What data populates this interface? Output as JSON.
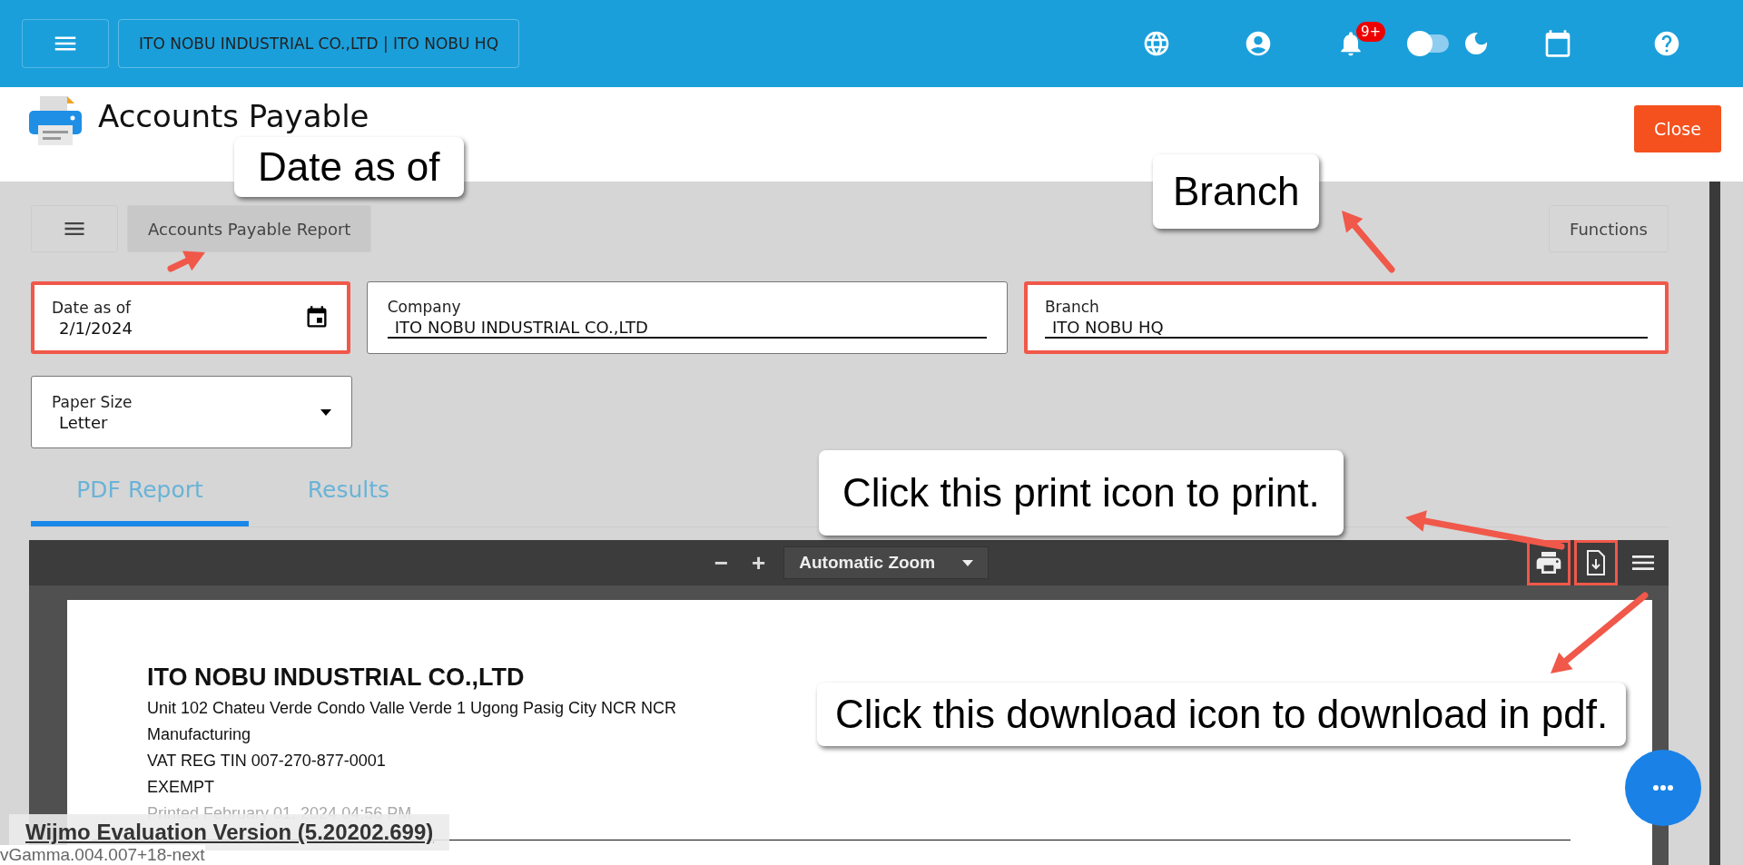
{
  "top_bar": {
    "company_branch": "ITO NOBU INDUSTRIAL CO.,LTD | ITO NOBU HQ",
    "notification_badge": "9+",
    "dark_mode": false
  },
  "header": {
    "title": "Accounts Payable",
    "close_button": "Close"
  },
  "toolbar": {
    "report_tab": "Accounts Payable Report",
    "functions_button": "Functions"
  },
  "fields": [
    {
      "kind": "date",
      "label": "Date as of",
      "value": "2/1/2024",
      "highlighted": true
    },
    {
      "kind": "text",
      "label": "Company",
      "value": "ITO NOBU INDUSTRIAL CO.,LTD",
      "highlighted": false
    },
    {
      "kind": "text",
      "label": "Branch",
      "value": "ITO NOBU HQ",
      "highlighted": true
    },
    {
      "kind": "select",
      "label": "Paper Size",
      "value": "Letter",
      "highlighted": false
    }
  ],
  "tabs": [
    {
      "label": "PDF Report",
      "selected": true
    },
    {
      "label": "Results",
      "selected": false
    }
  ],
  "pdf_viewer": {
    "zoom_out": "−",
    "zoom_in": "+",
    "zoom_select": "Automatic Zoom",
    "tools": [
      {
        "kind": "print",
        "highlighted": true
      },
      {
        "kind": "download",
        "highlighted": true
      },
      {
        "kind": "menu",
        "highlighted": false
      }
    ],
    "page_lines": [
      {
        "kind": "title",
        "text": "ITO NOBU INDUSTRIAL CO.,LTD"
      },
      {
        "kind": "line",
        "text": "Unit 102 Chateu Verde Condo Valle Verde 1 Ugong  Pasig City NCR NCR"
      },
      {
        "kind": "line",
        "text": "Manufacturing"
      },
      {
        "kind": "line",
        "text": "VAT REG TIN 007-270-877-0001"
      },
      {
        "kind": "line",
        "text": "EXEMPT"
      },
      {
        "kind": "muted",
        "text": "Printed February 01, 2024 04:56 PM"
      }
    ]
  },
  "footer": {
    "evaluation_notice": "Wijmo Evaluation Version (5.20202.699)",
    "version": "vGamma.004.007+18-next"
  },
  "callouts": [
    {
      "text": "Date as of"
    },
    {
      "text": "Branch"
    },
    {
      "text": "Click this print icon to print."
    },
    {
      "text": "Click this download icon to download in pdf."
    }
  ]
}
